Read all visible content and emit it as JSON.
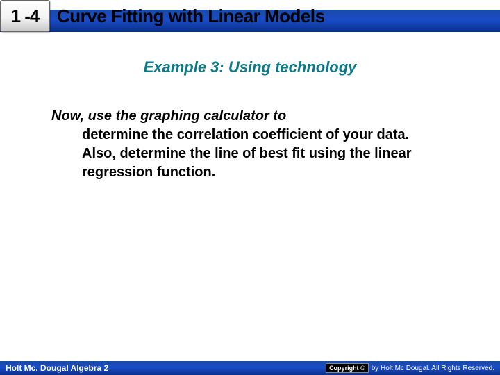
{
  "header": {
    "section_number": "1 -4",
    "title": "Curve Fitting with Linear Models"
  },
  "subtitle": "Example 3: Using technology",
  "body": {
    "first_line": "Now, use the graphing calculator to",
    "rest": "determine the correlation coefficient of your data. Also, determine the line of best fit using the linear regression function."
  },
  "footer": {
    "left": "Holt Mc. Dougal Algebra 2",
    "copyright_label": "Copyright ©",
    "copyright_text": "by Holt Mc Dougal. All Rights Reserved."
  }
}
